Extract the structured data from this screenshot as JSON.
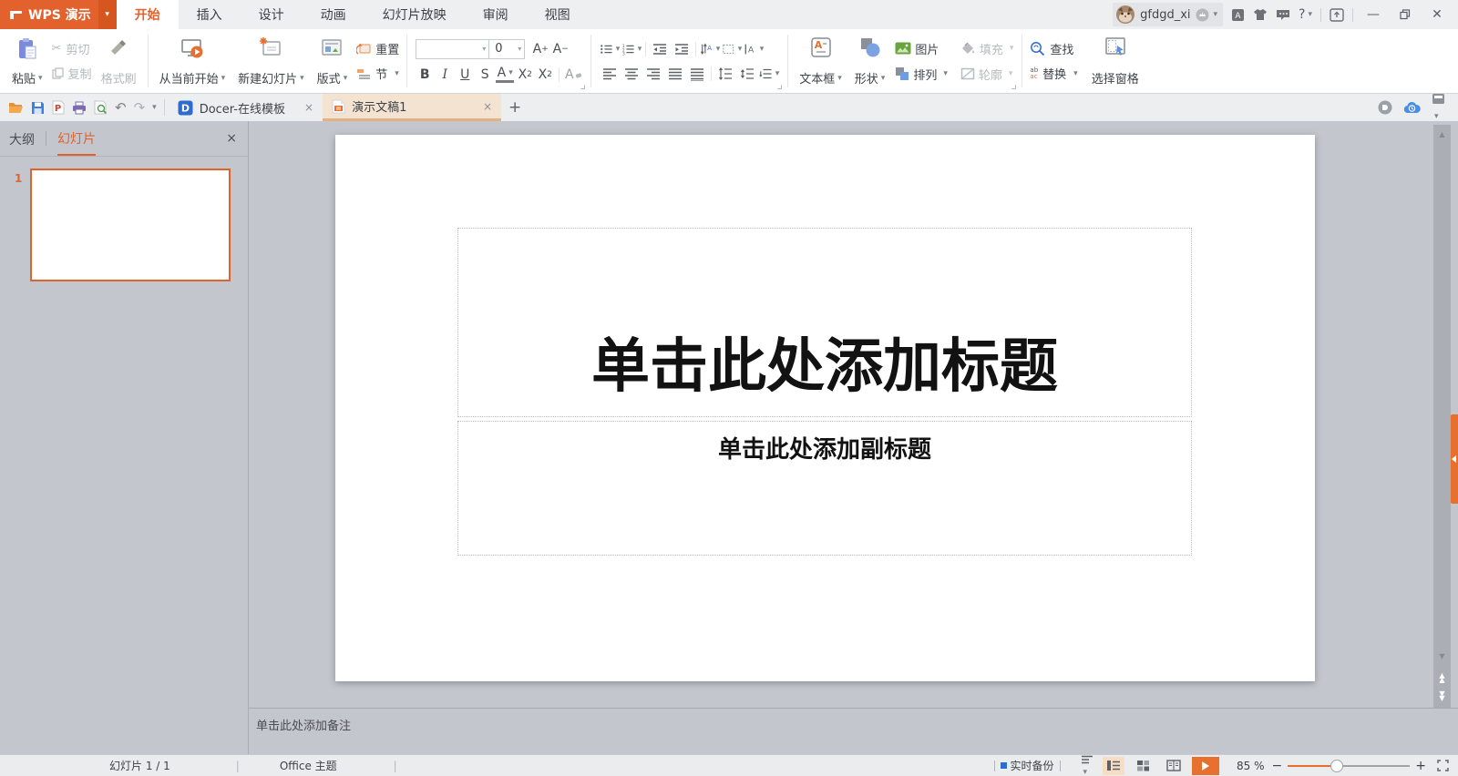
{
  "titlebar": {
    "logo_text": "WPS 演示",
    "tabs": [
      "开始",
      "插入",
      "设计",
      "动画",
      "幻灯片放映",
      "审阅",
      "视图"
    ],
    "username": "gfdgd_xi",
    "help_label": "?"
  },
  "ribbon": {
    "clipboard": {
      "paste": "粘贴",
      "cut": "剪切",
      "copy": "复制",
      "format_painter": "格式刷"
    },
    "slides": {
      "play_from_current": "从当前开始",
      "new_slide": "新建幻灯片",
      "layout": "版式",
      "reset": "重置",
      "section": "节"
    },
    "font": {
      "name_value": "",
      "size_value": "0",
      "grow_letter": "A",
      "grow_sign": "+",
      "shrink_letter": "A",
      "shrink_sign": "−",
      "bold": "B",
      "italic": "I",
      "underline": "U",
      "strikethrough": "S",
      "color_letter": "A",
      "sup_letter": "X",
      "sup_mark": "2",
      "sub_letter": "X",
      "sub_mark": "2",
      "clear_letter": "A"
    },
    "insert": {
      "text_box": "文本框",
      "shape": "形状",
      "picture": "图片",
      "fill": "填充",
      "arrange": "排列",
      "outline": "轮廓",
      "textbox_icon_letter": "A"
    },
    "editing": {
      "find": "查找",
      "replace": "替换",
      "selection_pane": "选择窗格",
      "replace_icon_top": "ab",
      "replace_icon_bottom": "ac"
    }
  },
  "docbar": {
    "docer_tab": "Docer-在线模板",
    "doc_tab": "演示文稿1",
    "docer_icon_letter": "D",
    "pdf_icon_letter": "P",
    "close_glyph": "×",
    "new_tab_glyph": "+"
  },
  "sidebar": {
    "outline_tab": "大纲",
    "slides_tab": "幻灯片",
    "slide_number": "1",
    "close_glyph": "×"
  },
  "slide": {
    "title_placeholder": "单击此处添加标题",
    "subtitle_placeholder": "单击此处添加副标题"
  },
  "notes": {
    "placeholder": "单击此处添加备注"
  },
  "statusbar": {
    "slide_counter": "幻灯片 1 / 1",
    "theme": "Office 主题",
    "backup_label": "实时备份",
    "zoom_value": "85 %",
    "zoom_out": "−",
    "zoom_in": "+"
  },
  "colors": {
    "accent": "#e2612c",
    "active_doc_tab_bg": "#f4e3d0",
    "backup_square": "#2f6cd0"
  }
}
